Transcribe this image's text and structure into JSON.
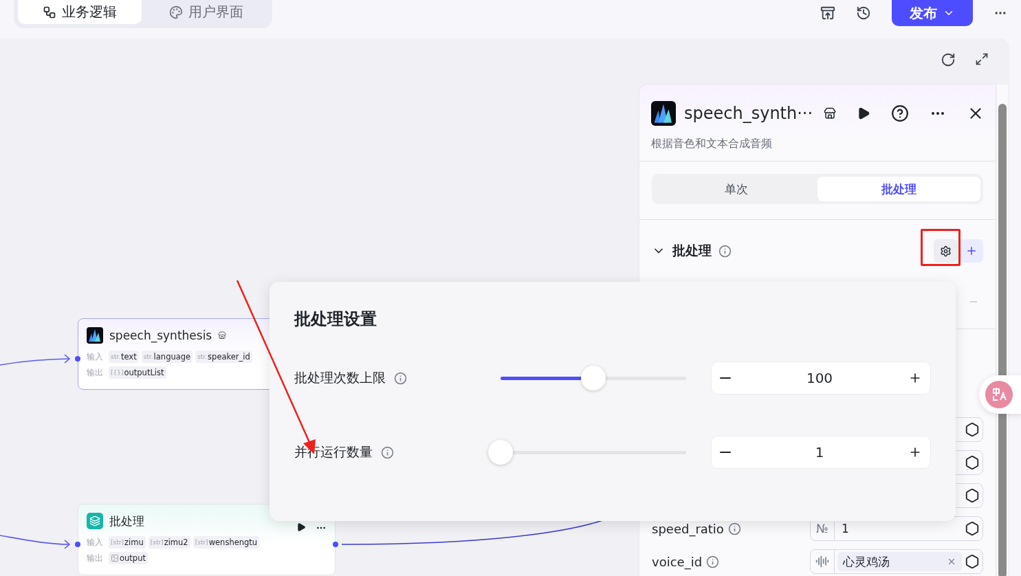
{
  "top_tabs": [
    {
      "label": "业务逻辑",
      "selected": true
    },
    {
      "label": "用户界面",
      "selected": false
    }
  ],
  "publish_button": {
    "label": "发布"
  },
  "nodes": [
    {
      "kind": "plugin",
      "title": "speech_synthesis",
      "input_label": "输入",
      "inputs": [
        {
          "type": "str.",
          "name": "text"
        },
        {
          "type": "str.",
          "name": "language"
        },
        {
          "type": "str.",
          "name": "speaker_id"
        }
      ],
      "output_label": "输出",
      "outputs": [
        {
          "type": "[{}]",
          "name": "outputList"
        }
      ]
    },
    {
      "kind": "batch",
      "title": "批处理",
      "input_label": "输入",
      "inputs": [
        {
          "type": "[str]",
          "name": "zimu"
        },
        {
          "type": "[str]",
          "name": "zimu2"
        },
        {
          "type": "[str]",
          "name": "wenshengtu"
        }
      ],
      "output_label": "输出",
      "outputs": [
        {
          "name": "output"
        }
      ]
    }
  ],
  "side_panel": {
    "title": "speech_synth···",
    "description": "根据音色和文本合成音频",
    "mode_tabs": [
      {
        "label": "单次",
        "selected": false
      },
      {
        "label": "批处理",
        "selected": true
      }
    ],
    "section": {
      "title": "批处理",
      "expanded": true
    },
    "params": [
      {
        "kind": "number",
        "name": "speed_ratio",
        "badge": "№",
        "value": "1"
      },
      {
        "kind": "voice",
        "name": "voice_id",
        "value": "心灵鸡汤"
      }
    ]
  },
  "batch_settings": {
    "title": "批处理设置",
    "rows": [
      {
        "label": "批处理次数上限",
        "level": 0.5,
        "value": "100"
      },
      {
        "label": "并行运行数量",
        "level": 0,
        "value": "1"
      }
    ]
  }
}
